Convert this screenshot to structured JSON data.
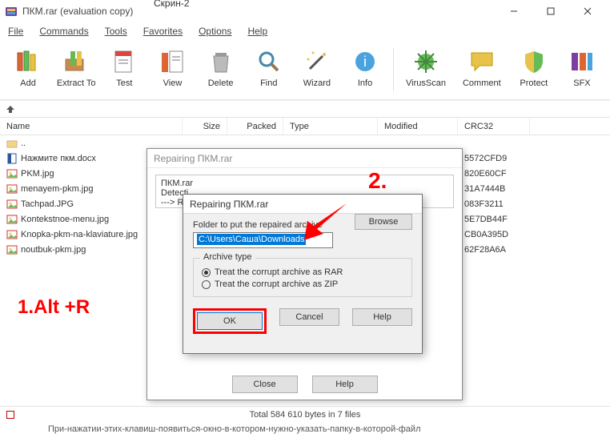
{
  "external_tab": "Скрин-2",
  "window": {
    "title": "ПКМ.rar (evaluation copy)"
  },
  "menu": {
    "file": "File",
    "commands": "Commands",
    "tools": "Tools",
    "favorites": "Favorites",
    "options": "Options",
    "help": "Help"
  },
  "toolbar": {
    "add": "Add",
    "extract": "Extract To",
    "test": "Test",
    "view": "View",
    "delete": "Delete",
    "find": "Find",
    "wizard": "Wizard",
    "info": "Info",
    "virus": "VirusScan",
    "comment": "Comment",
    "protect": "Protect",
    "sfx": "SFX"
  },
  "columns": {
    "name": "Name",
    "size": "Size",
    "packed": "Packed",
    "type": "Type",
    "modified": "Modified",
    "crc": "CRC32"
  },
  "files": [
    {
      "name": "..",
      "icon": "folder-up",
      "crc": ""
    },
    {
      "name": "Нажмите пкм.docx",
      "icon": "docx",
      "crc": "5572CFD9"
    },
    {
      "name": "PKM.jpg",
      "icon": "jpg",
      "crc": "820E60CF"
    },
    {
      "name": "menayem-pkm.jpg",
      "icon": "jpg",
      "crc": "31A7444B"
    },
    {
      "name": "Tachpad.JPG",
      "icon": "jpg",
      "crc": "083F3211"
    },
    {
      "name": "Kontekstnoe-menu.jpg",
      "icon": "jpg",
      "crc": "5E7DB44F"
    },
    {
      "name": "Knopka-pkm-na-klaviature.jpg",
      "icon": "jpg",
      "crc": "CB0A395D"
    },
    {
      "name": "noutbuk-pkm.jpg",
      "icon": "jpg",
      "crc": "62F28A6A"
    }
  ],
  "status": "Total 584 610 bytes in 7 files",
  "outer_text": "При-нажатии-этих-клавиш-появиться-окно-в-котором-нужно-указать-папку-в-которой-файл",
  "dlg_back": {
    "title": "Repairing ПКМ.rar",
    "log_line1": "ПКМ.rar",
    "log_line2": "Detecti",
    "log_line3": "---> RA",
    "close": "Close",
    "help": "Help"
  },
  "dlg_front": {
    "title": "Repairing ПКМ.rar",
    "folder_label": "Folder to put the repaired archive",
    "folder_value": "C:\\Users\\Саша\\Downloads",
    "browse": "Browse",
    "group_label": "Archive type",
    "opt_rar": "Treat the corrupt archive as RAR",
    "opt_zip": "Treat the corrupt archive as ZIP",
    "ok": "OK",
    "cancel": "Cancel",
    "help": "Help"
  },
  "annotations": {
    "one": "1.Alt +R",
    "two": "2."
  }
}
